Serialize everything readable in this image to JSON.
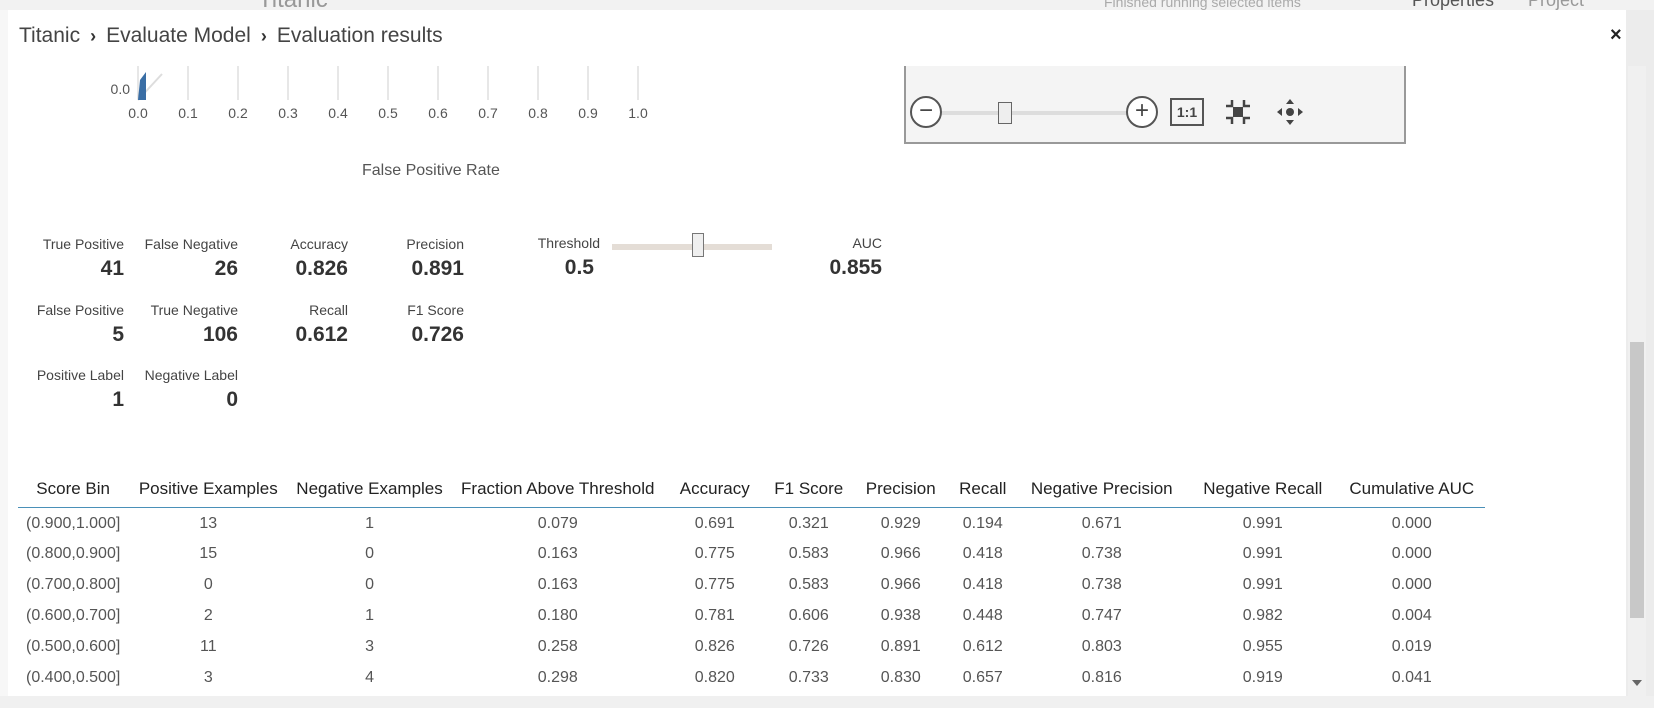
{
  "background": {
    "title": "Titanic",
    "status": "Finished running selected items",
    "tab_properties": "Properties",
    "tab_project": "Project"
  },
  "breadcrumb": {
    "items": [
      "Titanic",
      "Evaluate Model",
      "Evaluation results"
    ],
    "separator": "›"
  },
  "close_glyph": "×",
  "roc": {
    "xlabel": "False Positive Rate",
    "y_tick": "0.0",
    "x_ticks": [
      "0.0",
      "0.1",
      "0.2",
      "0.3",
      "0.4",
      "0.5",
      "0.6",
      "0.7",
      "0.8",
      "0.9",
      "1.0"
    ]
  },
  "viewer": {
    "zoom_out": "−",
    "zoom_in": "+",
    "actual_size": "1:1",
    "fit_icon": "fit-to-screen-icon",
    "pan_icon": "pan-icon"
  },
  "metrics": {
    "true_positive": {
      "label": "True Positive",
      "value": "41"
    },
    "false_negative": {
      "label": "False Negative",
      "value": "26"
    },
    "accuracy": {
      "label": "Accuracy",
      "value": "0.826"
    },
    "precision": {
      "label": "Precision",
      "value": "0.891"
    },
    "threshold": {
      "label": "Threshold",
      "value": "0.5"
    },
    "auc": {
      "label": "AUC",
      "value": "0.855"
    },
    "false_positive": {
      "label": "False Positive",
      "value": "5"
    },
    "true_negative": {
      "label": "True Negative",
      "value": "106"
    },
    "recall": {
      "label": "Recall",
      "value": "0.612"
    },
    "f1_score": {
      "label": "F1 Score",
      "value": "0.726"
    },
    "positive_label": {
      "label": "Positive Label",
      "value": "1"
    },
    "negative_label": {
      "label": "Negative Label",
      "value": "0"
    }
  },
  "table": {
    "columns": [
      "Score Bin",
      "Positive Examples",
      "Negative Examples",
      "Fraction Above Threshold",
      "Accuracy",
      "F1 Score",
      "Precision",
      "Recall",
      "Negative Precision",
      "Negative Recall",
      "Cumulative AUC"
    ],
    "rows": [
      [
        "(0.900,1.000]",
        "13",
        "1",
        "0.079",
        "0.691",
        "0.321",
        "0.929",
        "0.194",
        "0.671",
        "0.991",
        "0.000"
      ],
      [
        "(0.800,0.900]",
        "15",
        "0",
        "0.163",
        "0.775",
        "0.583",
        "0.966",
        "0.418",
        "0.738",
        "0.991",
        "0.000"
      ],
      [
        "(0.700,0.800]",
        "0",
        "0",
        "0.163",
        "0.775",
        "0.583",
        "0.966",
        "0.418",
        "0.738",
        "0.991",
        "0.000"
      ],
      [
        "(0.600,0.700]",
        "2",
        "1",
        "0.180",
        "0.781",
        "0.606",
        "0.938",
        "0.448",
        "0.747",
        "0.982",
        "0.004"
      ],
      [
        "(0.500,0.600]",
        "11",
        "3",
        "0.258",
        "0.826",
        "0.726",
        "0.891",
        "0.612",
        "0.803",
        "0.955",
        "0.019"
      ],
      [
        "(0.400,0.500]",
        "3",
        "4",
        "0.298",
        "0.820",
        "0.733",
        "0.830",
        "0.657",
        "0.816",
        "0.919",
        "0.041"
      ]
    ]
  },
  "colors": {
    "accent_line": "#4a90b8",
    "roc_curve": "#3a6ea5"
  }
}
